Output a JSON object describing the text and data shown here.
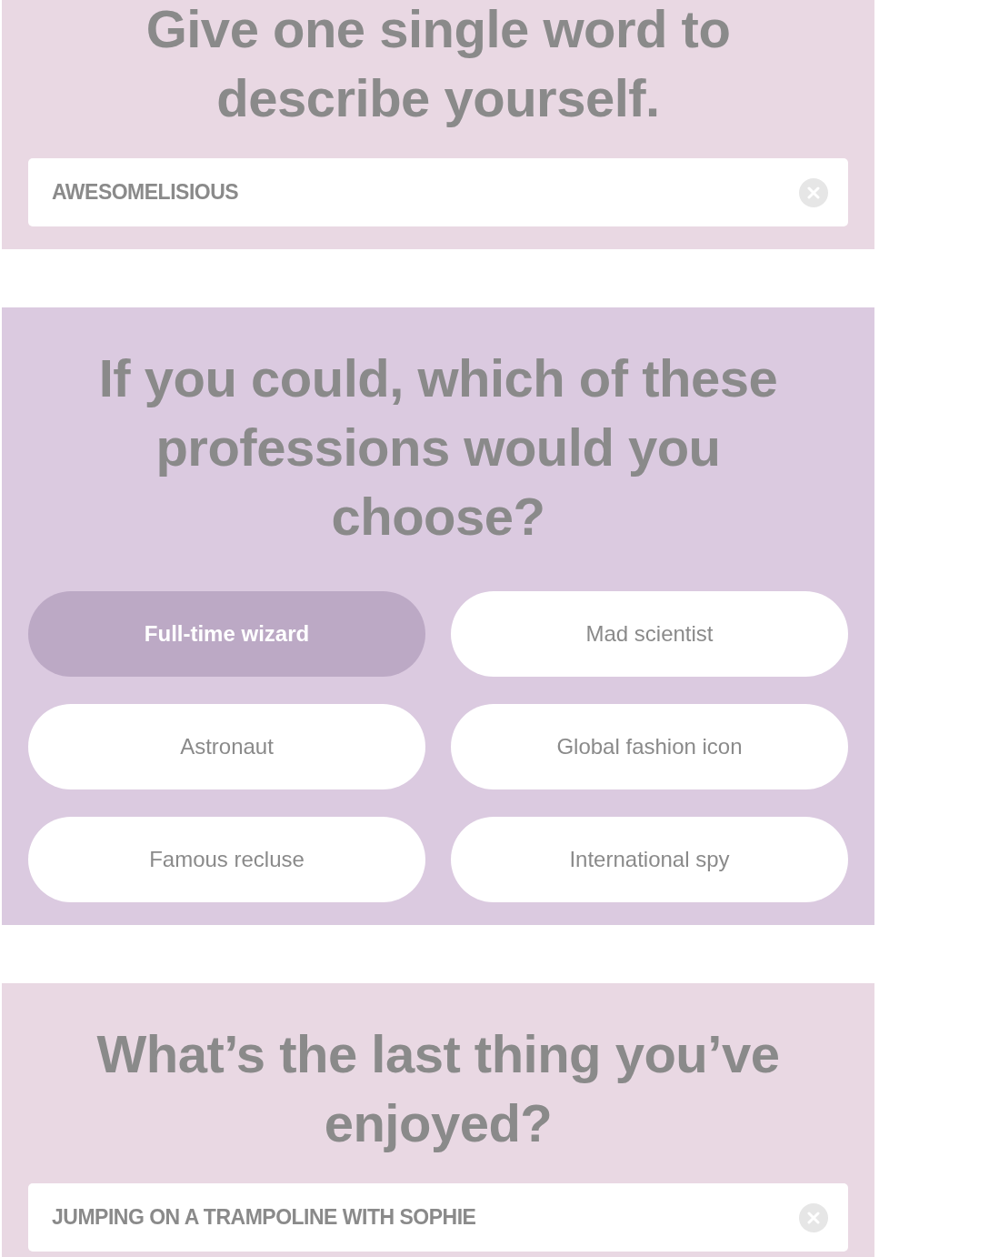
{
  "sections": [
    {
      "kind": "text",
      "question": "Give one single word to describe yourself.",
      "value": "AWESOMELISIOUS"
    },
    {
      "kind": "choice",
      "question": "If you could, which of these professions would you choose?",
      "options": [
        {
          "label": "Full-time wizard",
          "selected": true
        },
        {
          "label": "Mad scientist",
          "selected": false
        },
        {
          "label": "Astronaut",
          "selected": false
        },
        {
          "label": "Global fashion icon",
          "selected": false
        },
        {
          "label": "Famous recluse",
          "selected": false
        },
        {
          "label": "International spy",
          "selected": false
        }
      ]
    },
    {
      "kind": "text",
      "question": "What’s the last thing you’ve enjoyed?",
      "value": "JUMPING ON A TRAMPOLINE WITH SOPHIE"
    }
  ]
}
